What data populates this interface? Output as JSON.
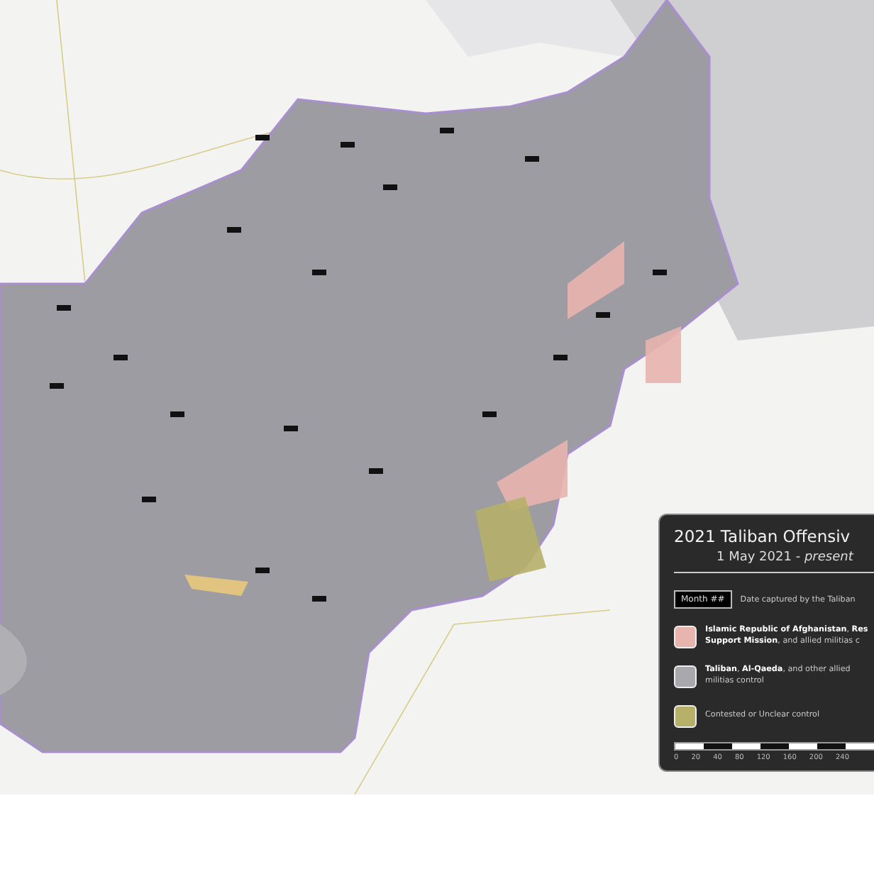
{
  "legend": {
    "title": "2021 Taliban Offensiv",
    "subtitle": "1 May 2021 - *present*",
    "date_key": {
      "tag": "Month ##",
      "label": "Date captured by the Taliban"
    },
    "entries": [
      {
        "color": "#e8b4ae",
        "lines": [
          "**Islamic Republic of Afghanistan**, **Res**",
          "**Support Mission**, and allied militias c"
        ]
      },
      {
        "color": "#a9a9ad",
        "lines": [
          "**Taliban**, **Al-Qaeda**, and other allied",
          "militias control"
        ]
      },
      {
        "color": "#b6b069",
        "lines": [
          "Contested or Unclear control"
        ]
      }
    ],
    "scale_ticks": [
      "0",
      "20",
      "40",
      "80",
      "120",
      "160",
      "200",
      "240"
    ]
  }
}
